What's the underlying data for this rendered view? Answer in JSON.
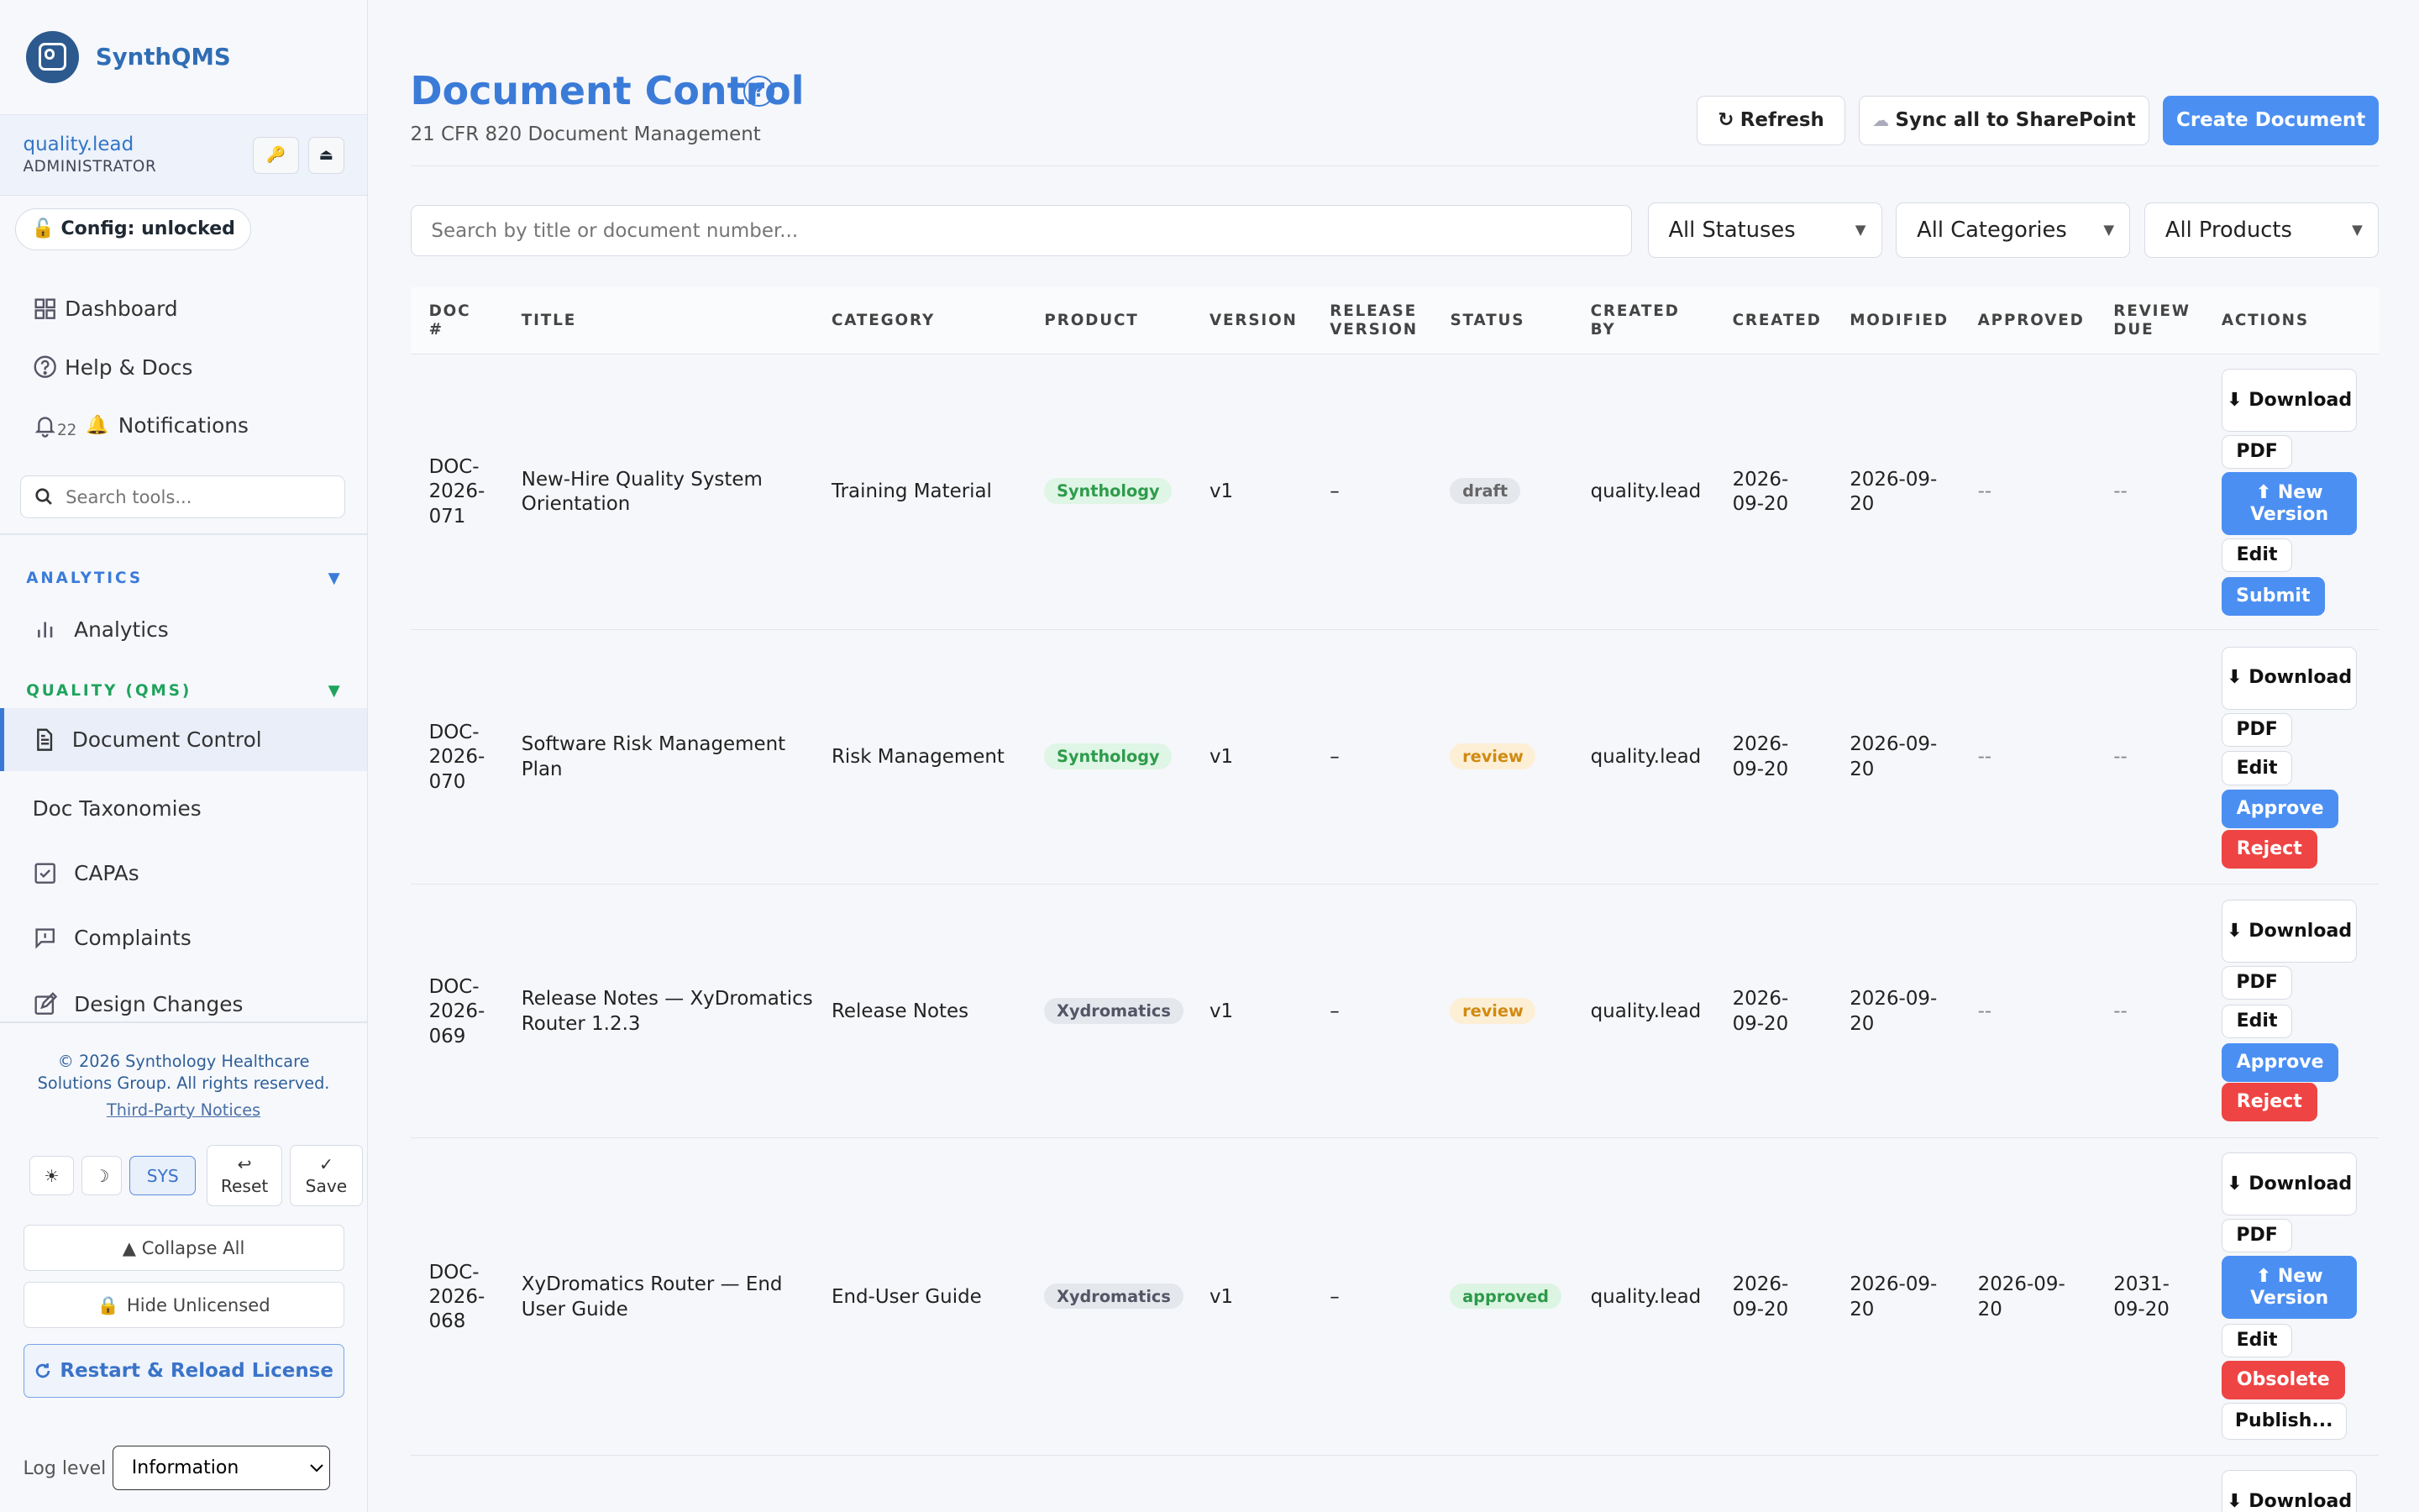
{
  "sidebar": {
    "brand": "SynthQMS",
    "user": {
      "name": "quality.lead",
      "role": "ADMINISTRATOR"
    },
    "key_glyph": "🔑",
    "eject_glyph": "⏏",
    "config_badge": "Config: unlocked",
    "nav": {
      "dashboard": "Dashboard",
      "help": "Help & Docs",
      "notifications_count": "22",
      "notifications": "Notifications"
    },
    "search_placeholder": "Search tools...",
    "sections": {
      "analytics": {
        "label": "ANALYTICS",
        "color": "#3b7bd8"
      },
      "qms": {
        "label": "QUALITY (QMS)",
        "color": "#1fa35c"
      }
    },
    "items": {
      "analytics": "Analytics",
      "document_control": "Document Control",
      "doc_taxonomies": "Doc Taxonomies",
      "capas": "CAPAs",
      "complaints": "Complaints",
      "design_changes": "Design Changes"
    },
    "footer": {
      "copyright": "© 2026 Synthology Healthcare Solutions Group. All rights reserved.",
      "third_party": "Third-Party Notices"
    },
    "theme": {
      "light": "☀",
      "dark": "☽",
      "sys": "SYS"
    },
    "reset": {
      "icon": "↩",
      "label": "Reset"
    },
    "save": {
      "icon": "✓",
      "label": "Save"
    },
    "collapse_all": "▲ Collapse All",
    "hide_unlicensed": "Hide Unlicensed",
    "restart_reload": "Restart & Reload License",
    "log_level_label": "Log level",
    "log_level_value": "Information"
  },
  "main": {
    "title": "Document Control",
    "subtitle": "21 CFR 820 Document Management",
    "refresh": "Refresh",
    "sync": "Sync all to SharePoint",
    "create": "Create Document",
    "search_placeholder": "Search by title or document number...",
    "filters": {
      "status": "All Statuses",
      "category": "All Categories",
      "product": "All Products"
    },
    "columns": {
      "doc_no": [
        "DOC",
        "#"
      ],
      "title": "TITLE",
      "category": "CATEGORY",
      "product": "PRODUCT",
      "version": "VERSION",
      "release_version": [
        "RELEASE",
        "VERSION"
      ],
      "status": "STATUS",
      "created_by": [
        "CREATED",
        "BY"
      ],
      "created": "CREATED",
      "modified": "MODIFIED",
      "approved": "APPROVED",
      "review_due": [
        "REVIEW",
        "DUE"
      ],
      "actions": "ACTIONS"
    },
    "rows": [
      {
        "doc": [
          "DOC-",
          "2026-",
          "071"
        ],
        "title": [
          "New-Hire Quality System",
          "Orientation"
        ],
        "category": "Training Material",
        "product": "Synthology",
        "version": "v1",
        "release": "–",
        "status": "draft",
        "created_by": "quality.lead",
        "created": [
          "2026-",
          "09-20"
        ],
        "modified": [
          "2026-09-",
          "20"
        ],
        "approved": [
          "--"
        ],
        "review_due": [
          "--"
        ],
        "actions": {
          "download": "⬇ Download",
          "pdf": "PDF",
          "new_version": "⬆ New Version",
          "edit": "Edit",
          "submit": "Submit"
        }
      },
      {
        "doc": [
          "DOC-",
          "2026-",
          "070"
        ],
        "title": [
          "Software Risk Management",
          "Plan"
        ],
        "category": "Risk Management",
        "product": "Synthology",
        "version": "v1",
        "release": "–",
        "status": "review",
        "created_by": "quality.lead",
        "created": [
          "2026-",
          "09-20"
        ],
        "modified": [
          "2026-09-",
          "20"
        ],
        "approved": [
          "--"
        ],
        "review_due": [
          "--"
        ],
        "actions": {
          "download": "⬇ Download",
          "pdf": "PDF",
          "edit": "Edit",
          "approve": "Approve",
          "reject": "Reject"
        }
      },
      {
        "doc": [
          "DOC-",
          "2026-",
          "069"
        ],
        "title": [
          "Release Notes — XyDromatics",
          "Router 1.2.3"
        ],
        "category": "Release Notes",
        "product": "Xydromatics",
        "version": "v1",
        "release": "–",
        "status": "review",
        "created_by": "quality.lead",
        "created": [
          "2026-",
          "09-20"
        ],
        "modified": [
          "2026-09-",
          "20"
        ],
        "approved": [
          "--"
        ],
        "review_due": [
          "--"
        ],
        "actions": {
          "download": "⬇ Download",
          "pdf": "PDF",
          "edit": "Edit",
          "approve": "Approve",
          "reject": "Reject"
        }
      },
      {
        "doc": [
          "DOC-",
          "2026-",
          "068"
        ],
        "title": [
          "XyDromatics Router — End",
          "User Guide"
        ],
        "category": "End-User Guide",
        "product": "Xydromatics",
        "version": "v1",
        "release": "–",
        "status": "approved",
        "created_by": "quality.lead",
        "created": [
          "2026-",
          "09-20"
        ],
        "modified": [
          "2026-09-",
          "20"
        ],
        "approved": [
          "2026-09-",
          "20"
        ],
        "review_due": [
          "2031-",
          "09-20"
        ],
        "actions": {
          "download": "⬇ Download",
          "pdf": "PDF",
          "new_version": "⬆ New Version",
          "edit": "Edit",
          "obsolete": "Obsolete",
          "publish": "Publish..."
        }
      },
      {
        "actions": {
          "download": "⬇ Download"
        }
      }
    ]
  }
}
